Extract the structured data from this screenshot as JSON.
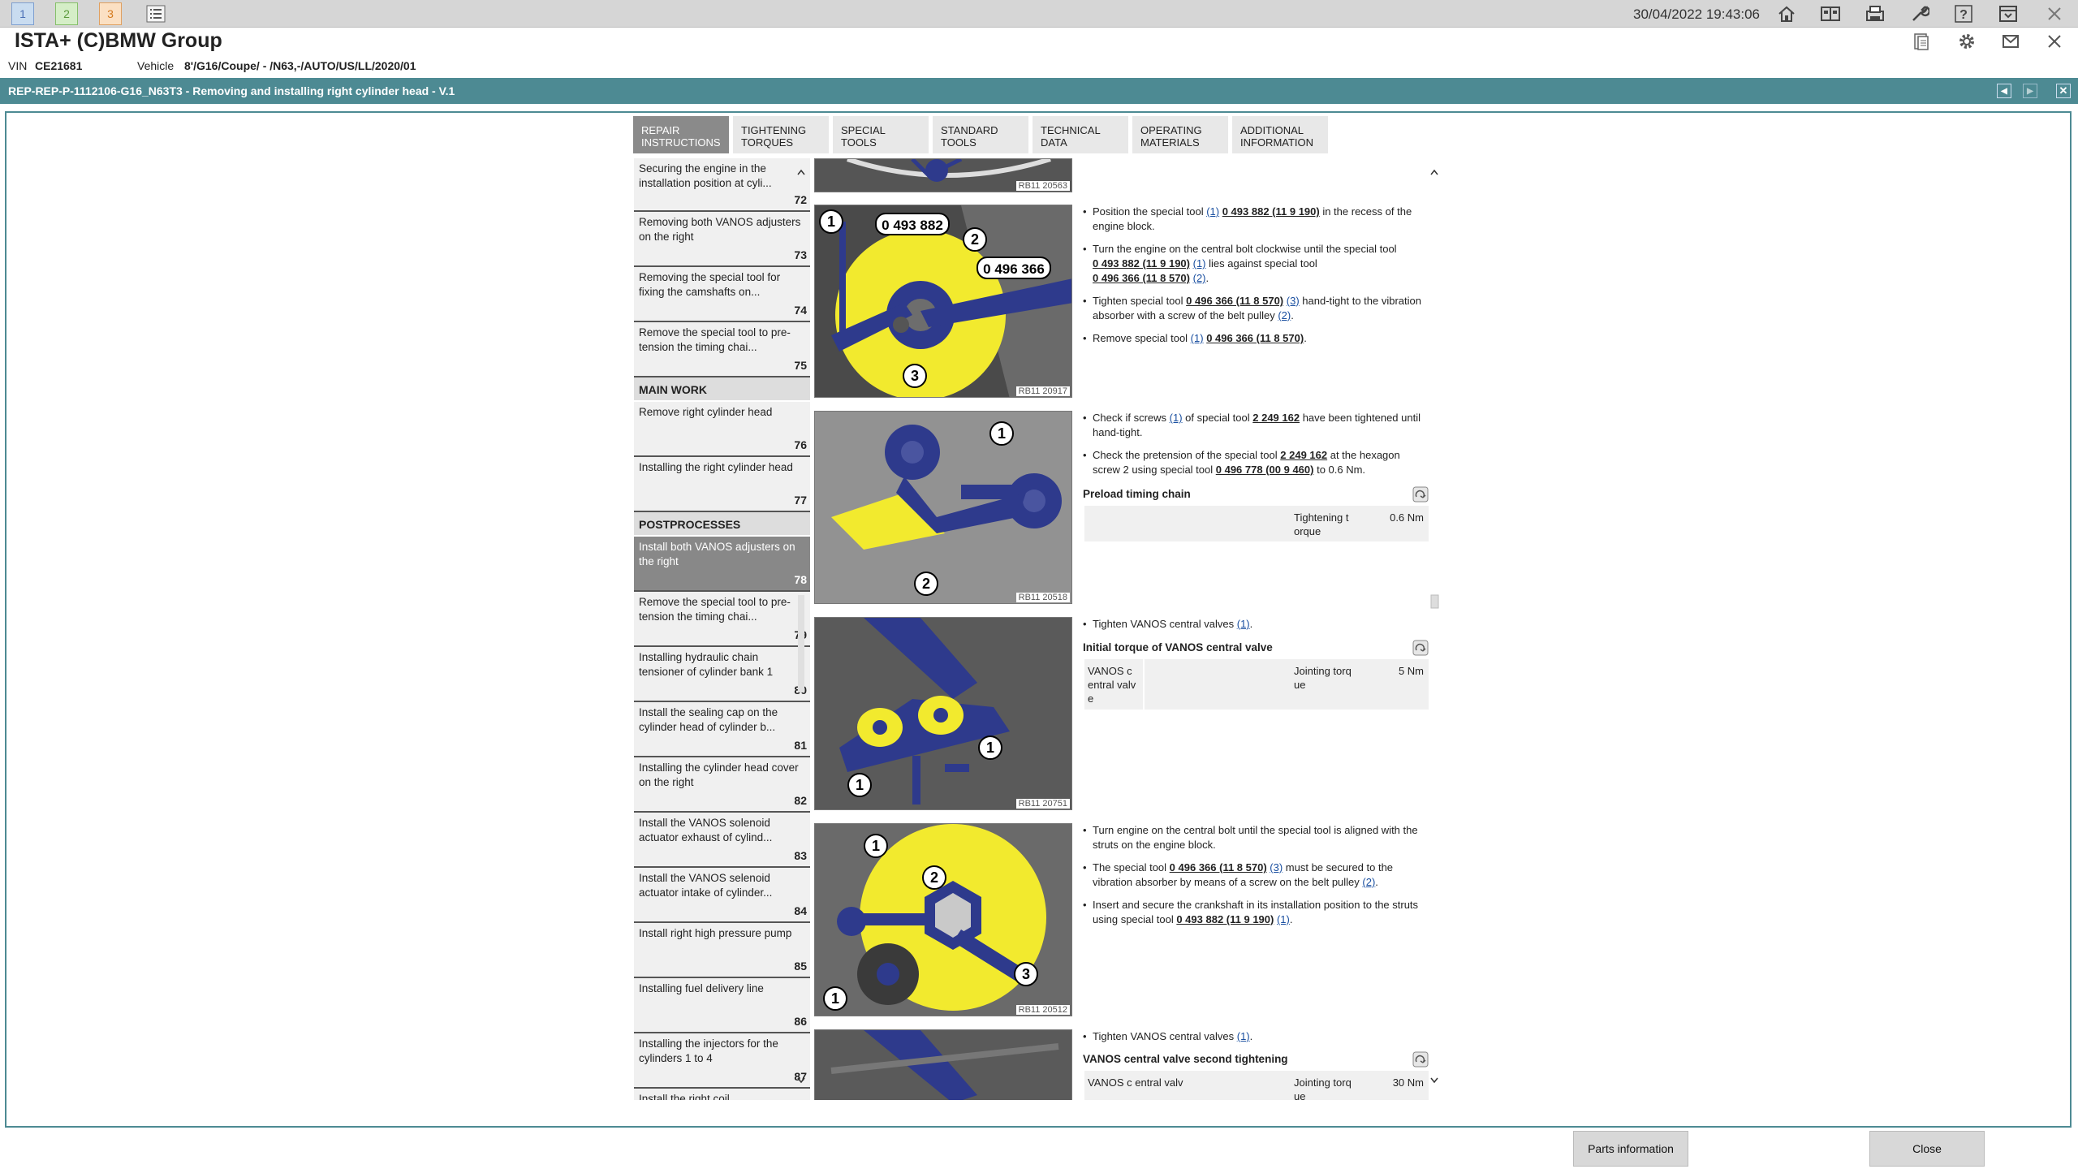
{
  "workspace": {
    "ws1": "1",
    "ws2": "2",
    "ws3": "3"
  },
  "header": {
    "datetime": "30/04/2022 19:43:06",
    "app_title": "ISTA+ (C)BMW Group"
  },
  "vehicle": {
    "vin_label": "VIN",
    "vin": "CE21681",
    "vehicle_label": "Vehicle",
    "vehicle": "8'/G16/Coupe/ - /N63,-/AUTO/US/LL/2020/01"
  },
  "document": {
    "title": "REP-REP-P-1112106-G16_N63T3 - Removing and installing right cylinder head - V.1"
  },
  "tabs": [
    {
      "label": "REPAIR INSTRUCTIONS"
    },
    {
      "label": "TIGHTENING TORQUES"
    },
    {
      "label": "SPECIAL TOOLS"
    },
    {
      "label": "STANDARD TOOLS"
    },
    {
      "label": "TECHNICAL DATA"
    },
    {
      "label": "OPERATING MATERIALS"
    },
    {
      "label": "ADDITIONAL INFORMATION"
    }
  ],
  "toc": {
    "items": [
      {
        "text": "Securing the engine in the installation position at cyli...",
        "num": "72"
      },
      {
        "text": "Removing both VANOS adjusters on the right",
        "num": "73"
      },
      {
        "text": "Removing the special tool for fixing the camshafts on...",
        "num": "74"
      },
      {
        "text": "Remove the special tool to pre-tension the timing chai...",
        "num": "75"
      },
      {
        "section": "MAIN WORK"
      },
      {
        "text": "Remove right cylinder head",
        "num": "76"
      },
      {
        "text": "Installing the right cylinder head",
        "num": "77"
      },
      {
        "section": "POSTPROCESSES"
      },
      {
        "text": "Install both VANOS adjusters on the right",
        "num": "78",
        "selected": true
      },
      {
        "text": "Remove the special tool to pre-tension the timing chai...",
        "num": "79"
      },
      {
        "text": "Installing hydraulic chain tensioner of cylinder bank 1",
        "num": "80"
      },
      {
        "text": "Install the sealing cap on the cylinder head of cylinder b...",
        "num": "81"
      },
      {
        "text": "Installing the cylinder head cover on the right",
        "num": "82"
      },
      {
        "text": "Install the VANOS solenoid actuator exhaust of cylind...",
        "num": "83"
      },
      {
        "text": "Install the VANOS selenoid actuator intake of cylinder...",
        "num": "84"
      },
      {
        "text": "Install right high pressure pump",
        "num": "85"
      },
      {
        "text": "Installing fuel delivery line",
        "num": "86"
      },
      {
        "text": "Installing the injectors for the cylinders 1 to 4",
        "num": "87"
      },
      {
        "text": "Install the right coil",
        "num": ""
      }
    ]
  },
  "images": [
    {
      "code": "RB11 20563"
    },
    {
      "code": "RB11 20917",
      "tool1": "0 493 882",
      "tool2": "0 496 366"
    },
    {
      "code": "RB11 20518"
    },
    {
      "code": "RB11 20751"
    },
    {
      "code": "RB11 20512"
    }
  ],
  "steps": {
    "s1": {
      "b1a": "Position the special tool ",
      "b1ref": "(1)",
      "b1tool": "0 493 882 (11 9 190)",
      "b1b": " in the recess of the engine block.",
      "b2a": "Turn the engine on the central bolt clockwise until the special tool ",
      "b2tool1": "0 493 882 (11 9 190)",
      "b2ref1": "(1)",
      "b2b": " lies against special tool ",
      "b2tool2": "0 496 366 (11 8 570)",
      "b2ref2": "(2)",
      "b3a": "Tighten special tool ",
      "b3tool": "0 496 366 (11 8 570)",
      "b3ref": "(3)",
      "b3b": " hand-tight to the vibration absorber with a screw of the belt pulley ",
      "b3ref2": "(2)",
      "b4a": "Remove special tool ",
      "b4ref": "(1)",
      "b4tool": "0 496 366 (11 8 570)"
    },
    "s2": {
      "b1a": "Check if screws ",
      "b1ref": "(1)",
      "b1b": " of special tool ",
      "b1tool": "2 249 162",
      "b1c": " have been tightened until hand-tight.",
      "b2a": "Check the pretension of the special tool ",
      "b2tool": "2 249 162",
      "b2b": " at the hexagon screw 2 using special tool ",
      "b2tool2": "0 496 778 (00 9 460)",
      "b2c": " to 0.6 Nm.",
      "header": "Preload timing chain",
      "t_label": "Tightening t orque",
      "t_value": "0.6  Nm"
    },
    "s3": {
      "b1a": "Tighten VANOS central valves ",
      "b1ref": "(1)",
      "header": "Initial torque of VANOS central valve",
      "t_name": "VANOS c entral valv e",
      "t_label": "Jointing torq ue",
      "t_value": "5  Nm"
    },
    "s4": {
      "b1": "Turn engine on the central bolt until the special tool is aligned with the struts on the engine block.",
      "b2a": "The special tool ",
      "b2tool": "0 496 366 (11 8 570)",
      "b2ref": "(3)",
      "b2b": " must be secured to the vibration absorber by means of a screw on the belt pulley ",
      "b2ref2": "(2)",
      "b3a": "Insert and secure the crankshaft in its installation position to the struts using special tool ",
      "b3tool": "0 493 882 (11 9 190)",
      "b3ref": "(1)"
    },
    "s5": {
      "b1a": "Tighten VANOS central valves ",
      "b1ref": "(1)",
      "header": "VANOS central valve second tightening",
      "t_name": "VANOS c entral valv",
      "t_label": "Jointing torq ue",
      "t_value": "30  Nm"
    }
  },
  "buttons": {
    "parts": "Parts information",
    "close": "Close"
  },
  "colors": {
    "accent": "#4d8a93",
    "highlight": "#f2ea2e",
    "part_blue": "#2e3a8c"
  }
}
